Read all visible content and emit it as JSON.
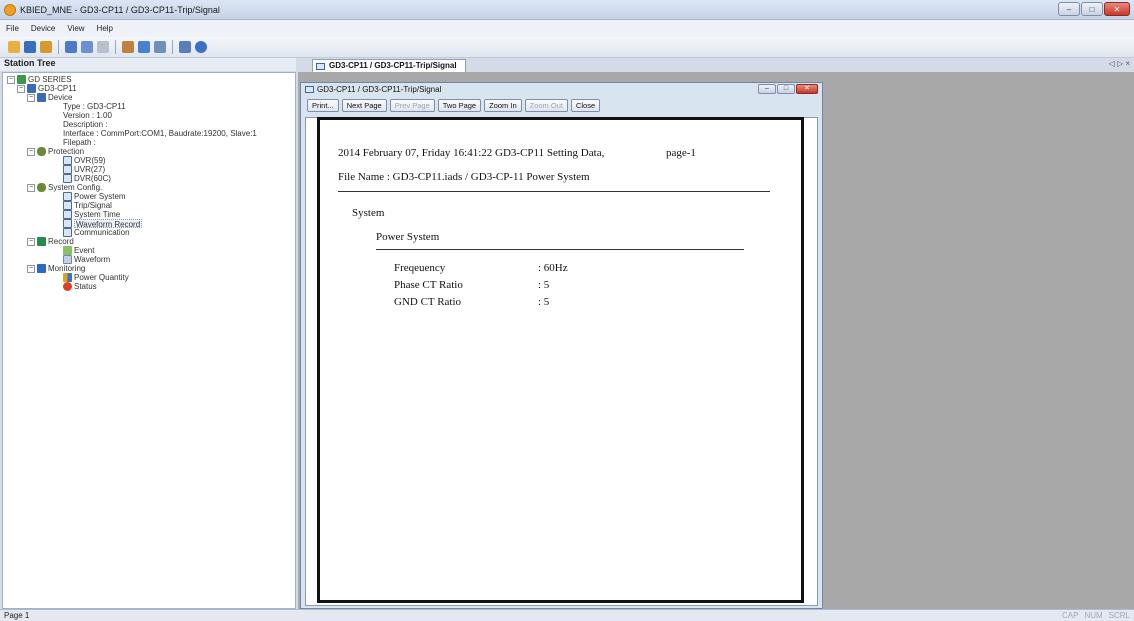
{
  "window": {
    "title": "KBIED_MNE - GD3-CP11 / GD3-CP11-Trip/Signal",
    "buttons": {
      "minimize": "–",
      "maximize": "□",
      "close": "✕"
    }
  },
  "menu": {
    "items": [
      "File",
      "Device",
      "View",
      "Help"
    ]
  },
  "toolbar": {
    "icons": [
      "open-folder-icon",
      "save-icon",
      "open-icon",
      "database-icon",
      "arrow-icon",
      "disconnect-icon",
      "settings-icon",
      "monitor-icon",
      "list-icon",
      "window-icon",
      "info-icon"
    ]
  },
  "station_tree": {
    "header": "Station Tree",
    "nodes": [
      {
        "label": "GD SERIES",
        "icon": "series-icon"
      },
      {
        "label": "GD3-CP11",
        "icon": "device-icon"
      },
      {
        "label": "Device",
        "icon": "device-icon"
      },
      {
        "label": "Type : GD3-CP11",
        "icon": ""
      },
      {
        "label": "Version : 1.00",
        "icon": ""
      },
      {
        "label": "Description :",
        "icon": ""
      },
      {
        "label": "Interface : CommPort:COM1, Baudrate:19200, Slave:1",
        "icon": ""
      },
      {
        "label": "Filepath :",
        "icon": ""
      },
      {
        "label": "Protection",
        "icon": "gears-icon"
      },
      {
        "label": "OVR(59)",
        "icon": "setting-icon"
      },
      {
        "label": "UVR(27)",
        "icon": "setting-icon"
      },
      {
        "label": "DVR(60C)",
        "icon": "setting-icon"
      },
      {
        "label": "System Config.",
        "icon": "gears-icon"
      },
      {
        "label": "Power System",
        "icon": "setting-icon"
      },
      {
        "label": "Trip/Signal",
        "icon": "setting-icon"
      },
      {
        "label": "System Time",
        "icon": "setting-icon"
      },
      {
        "label": "Waveform Record",
        "icon": "setting-icon"
      },
      {
        "label": "Communication",
        "icon": "setting-icon"
      },
      {
        "label": "Record",
        "icon": "record-icon"
      },
      {
        "label": "Event",
        "icon": "event-icon"
      },
      {
        "label": "Waveform",
        "icon": "waveform-icon"
      },
      {
        "label": "Monitoring",
        "icon": "monitor-icon"
      },
      {
        "label": "Power Quantity",
        "icon": "chart-icon"
      },
      {
        "label": "Status",
        "icon": "status-icon"
      }
    ]
  },
  "doc_tab": {
    "label": "GD3-CP11 / GD3-CP11-Trip/Signal",
    "nav": "◁ ▷ ×"
  },
  "mdi_window": {
    "title": "GD3-CP11 / GD3-CP11-Trip/Signal",
    "buttons": {
      "minimize": "–",
      "maximize": "□",
      "close": "✕"
    }
  },
  "preview_toolbar": {
    "print": "Print...",
    "next_page": "Next Page",
    "prev_page": "Prev Page",
    "two_page": "Two Page",
    "zoom_in": "Zoom In",
    "zoom_out": "Zoom Out",
    "close": "Close"
  },
  "report": {
    "header_line": "2014 February 07, Friday 16:41:22 GD3-CP11 Setting Data,",
    "page_label": "page-1",
    "file_name": "File Name : GD3-CP11.iads / GD3-CP-11 Power System",
    "section": "System",
    "subsection": "Power System",
    "rows": [
      {
        "label": "Freqeuency",
        "value": ": 60Hz"
      },
      {
        "label": "Phase CT Ratio",
        "value": ": 5"
      },
      {
        "label": "GND CT Ratio",
        "value": ": 5"
      }
    ]
  },
  "status_bar": {
    "left": "Page 1",
    "indicators": [
      "CAP",
      "NUM",
      "SCRL"
    ]
  }
}
